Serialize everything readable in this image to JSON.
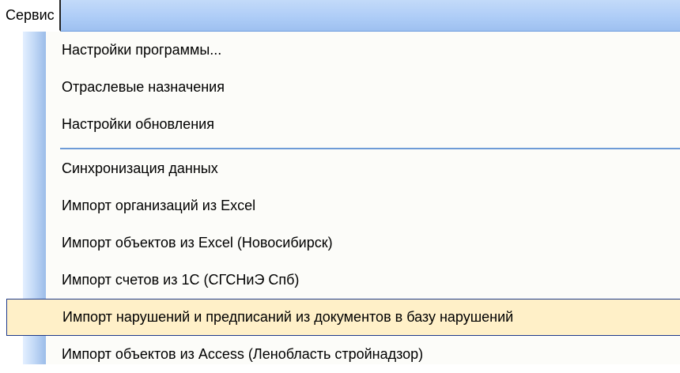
{
  "menubar": {
    "active_menu_label": "Сервис"
  },
  "dropdown": {
    "items": [
      {
        "label": "Настройки программы..."
      },
      {
        "label": "Отраслевые назначения"
      },
      {
        "label": "Настройки обновления"
      },
      {
        "label": "Синхронизация данных"
      },
      {
        "label": "Импорт организаций из Excel"
      },
      {
        "label": "Импорт объектов из Excel (Новосибирск)"
      },
      {
        "label": "Импорт счетов из 1С (СГСНиЭ Спб)"
      },
      {
        "label": "Импорт нарушений и предписаний из документов в базу нарушений"
      },
      {
        "label": "Импорт объектов из Access (Ленобласть стройнадзор)"
      }
    ],
    "highlighted_item": "Импорт нарушений и предписаний из документов в базу нарушений"
  },
  "colors": {
    "menubar": "#aecdf7",
    "gutter": "#9bbce9",
    "separator": "#6e9bd7",
    "highlight_fill": "#fff0c8",
    "highlight_border": "#1e3a8a"
  }
}
